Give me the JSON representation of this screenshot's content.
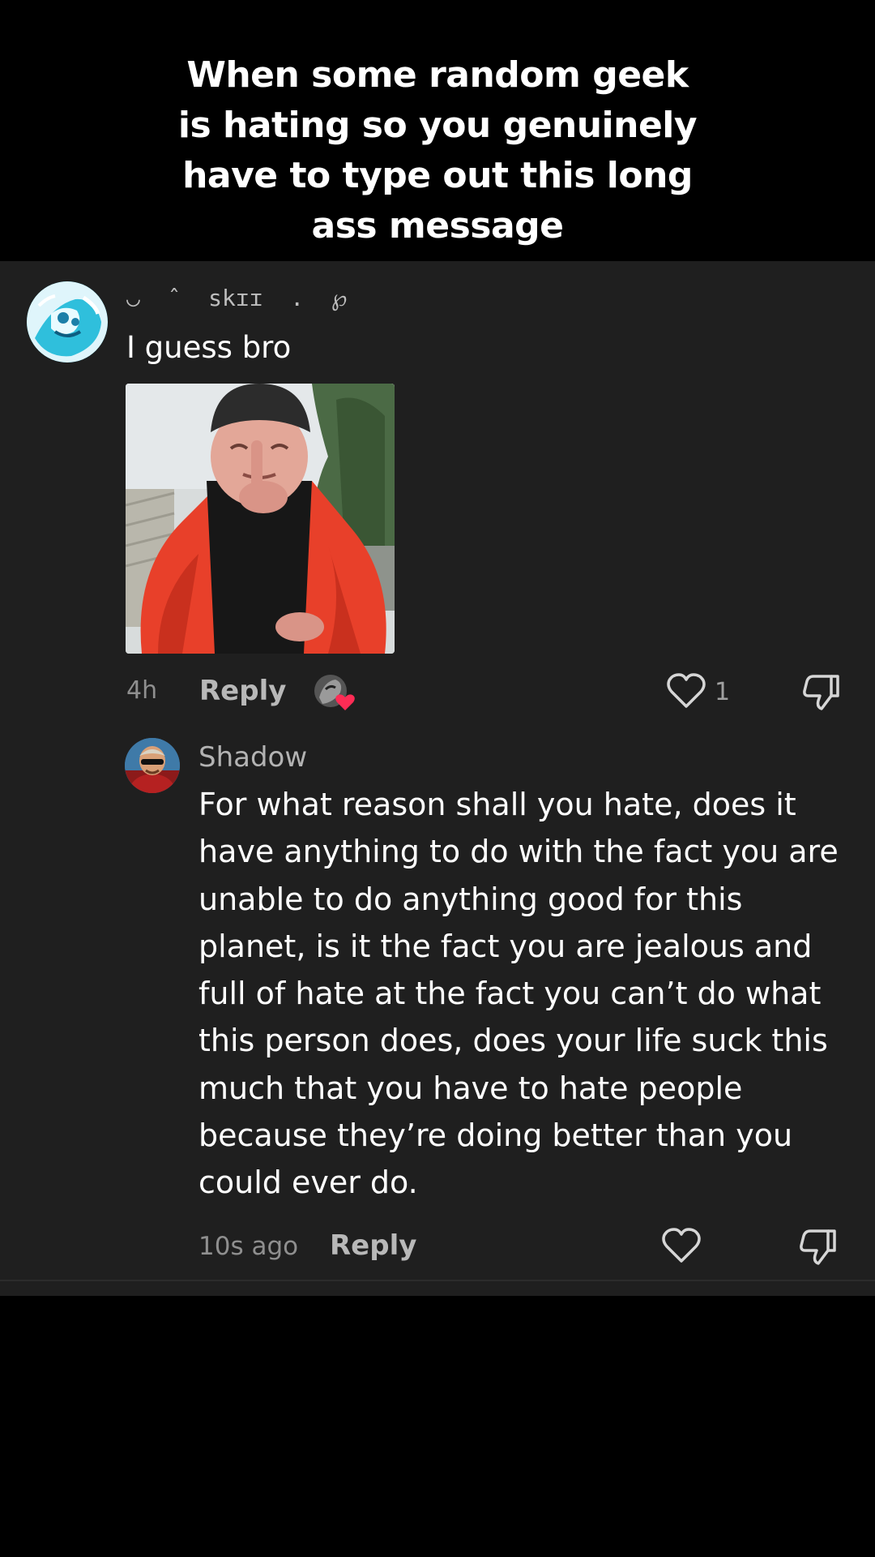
{
  "caption": {
    "lines": [
      "When some random geek",
      "is hating so you genuinely",
      "have to type out this long",
      "ass message"
    ]
  },
  "comment": {
    "username": "◡  ˆ  skɪɪ  .  ℘",
    "text": "I guess bro",
    "time": "4h",
    "reply_label": "Reply",
    "like_count": "1",
    "creator_liked": true
  },
  "reply": {
    "username": "Shadow",
    "lines": [
      "For what reason shall you hate, does it",
      "have anything to do with the fact you are",
      "unable to do anything good for this",
      "planet, is it the fact you are jealous and",
      "full of hate at the fact you can’t do what",
      "this person does, does your life suck this",
      "much that you have to hate people",
      "because they’re doing better than you",
      "could ever do."
    ],
    "time": "10s ago",
    "reply_label": "Reply"
  },
  "colors": {
    "background": "#000000",
    "panel": "#1f1f1f",
    "text": "#ffffff",
    "muted": "#8f8f8f",
    "accent_heart": "#fe2c55"
  },
  "icons": [
    "heart-outline-icon",
    "thumbs-down-icon",
    "creator-liked-heart-icon"
  ]
}
